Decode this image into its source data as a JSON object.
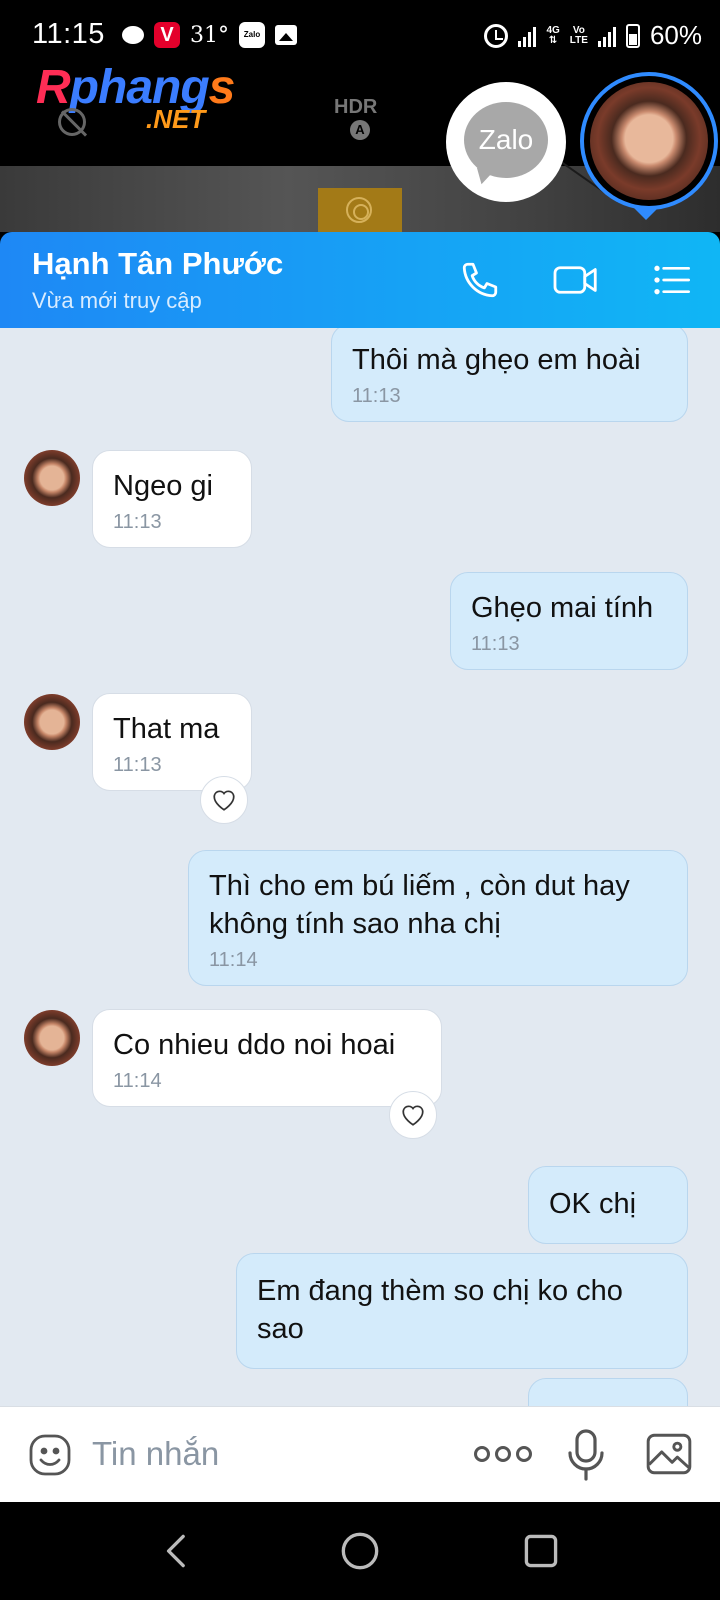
{
  "status_bar": {
    "time": "11:15",
    "temperature": "31°",
    "battery": "60%",
    "network_label": "4G",
    "network_sub": "LTE",
    "volte": "Vo"
  },
  "overlay": {
    "logo_main": [
      "R",
      "phang",
      "s"
    ],
    "logo_sub": ".NET",
    "hdr_label": "HDR",
    "hdr_mode": "A",
    "zalo_label": "Zalo"
  },
  "header": {
    "contact_name": "Hạnh Tân Phước",
    "contact_status": "Vừa mới truy cập"
  },
  "messages": [
    {
      "direction": "out",
      "text": "Thôi mà ghẹo em hoài",
      "time": "11:13"
    },
    {
      "direction": "in",
      "text": "Ngeo gi",
      "time": "11:13"
    },
    {
      "direction": "out",
      "text": "Ghẹo mai tính",
      "time": "11:13"
    },
    {
      "direction": "in",
      "text": "That ma",
      "time": "11:13"
    },
    {
      "direction": "out",
      "text": "Thì cho em bú liếm , còn dut hay không tính sao nha chị",
      "time": "11:14"
    },
    {
      "direction": "in",
      "text": "Co nhieu ddo noi hoai",
      "time": "11:14"
    },
    {
      "direction": "out",
      "text": "OK chị",
      "time": ""
    },
    {
      "direction": "out",
      "text": "Em đang thèm so chị ko cho sao",
      "time": ""
    }
  ],
  "composer": {
    "placeholder": "Tin nhắn"
  },
  "colors": {
    "header_start": "#1e88f5",
    "header_end": "#10b6f5",
    "chat_bg": "#e2e9f1",
    "outgoing_bubble": "#d4ebfb",
    "incoming_bubble": "#ffffff"
  },
  "icons": {
    "header": [
      "phone-icon",
      "video-call-icon",
      "list-menu-icon"
    ],
    "composer": [
      "sticker-icon",
      "more-options-icon",
      "microphone-icon",
      "image-icon"
    ],
    "nav": [
      "back-icon",
      "home-icon",
      "recents-icon"
    ]
  }
}
